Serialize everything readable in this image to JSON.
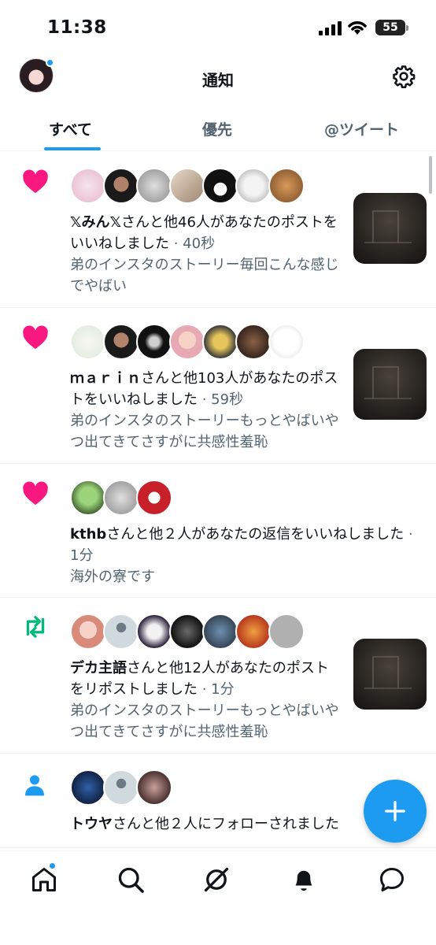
{
  "status_bar": {
    "time": "11:38",
    "battery": "55"
  },
  "header": {
    "title": "通知"
  },
  "tabs": [
    {
      "label": "すべて",
      "active": true
    },
    {
      "label": "優先",
      "active": false
    },
    {
      "label": "@ツイート",
      "active": false
    }
  ],
  "notifications": [
    {
      "type": "like",
      "icon": "heart-icon",
      "name": "𝕏みん𝕏",
      "text": "さんと他46人があなたのポストをいいねしました",
      "time": " · 40秒",
      "preview": "弟のインスタのストーリー毎回こんな感じでやばい",
      "has_thumbnail": true
    },
    {
      "type": "like",
      "icon": "heart-icon",
      "name": "ｍａｒｉｎ",
      "text": "さんと他103人があなたのポストをいいねしました",
      "time": " · 59秒",
      "preview": "弟のインスタのストーリーもっとやばいやつ出てきてさすがに共感性羞恥",
      "has_thumbnail": true
    },
    {
      "type": "like",
      "icon": "heart-icon",
      "name": "kthb",
      "text": "さんと他２人があなたの返信をいいねしました",
      "time": " · 1分",
      "preview": "海外の寮です",
      "has_thumbnail": false
    },
    {
      "type": "repost",
      "icon": "repost-icon",
      "name": "デカ主語",
      "text": "さんと他12人があなたのポストをリポストしました",
      "time": " · 1分",
      "preview": "弟のインスタのストーリーもっとやばいやつ出てきてさすがに共感性羞恥",
      "has_thumbnail": true
    },
    {
      "type": "follow",
      "icon": "person-icon",
      "name": "トウヤ",
      "text": "さんと他２人にフォローされました",
      "time": "",
      "preview": "",
      "has_thumbnail": false
    }
  ],
  "colors": {
    "accent": "#1d9bf0",
    "like": "#f91880",
    "repost": "#00ba7c",
    "text": "#0f1419",
    "secondary": "#536471"
  },
  "bottom_nav": [
    "home-icon",
    "search-icon",
    "grok-icon",
    "bell-icon",
    "messages-icon"
  ]
}
